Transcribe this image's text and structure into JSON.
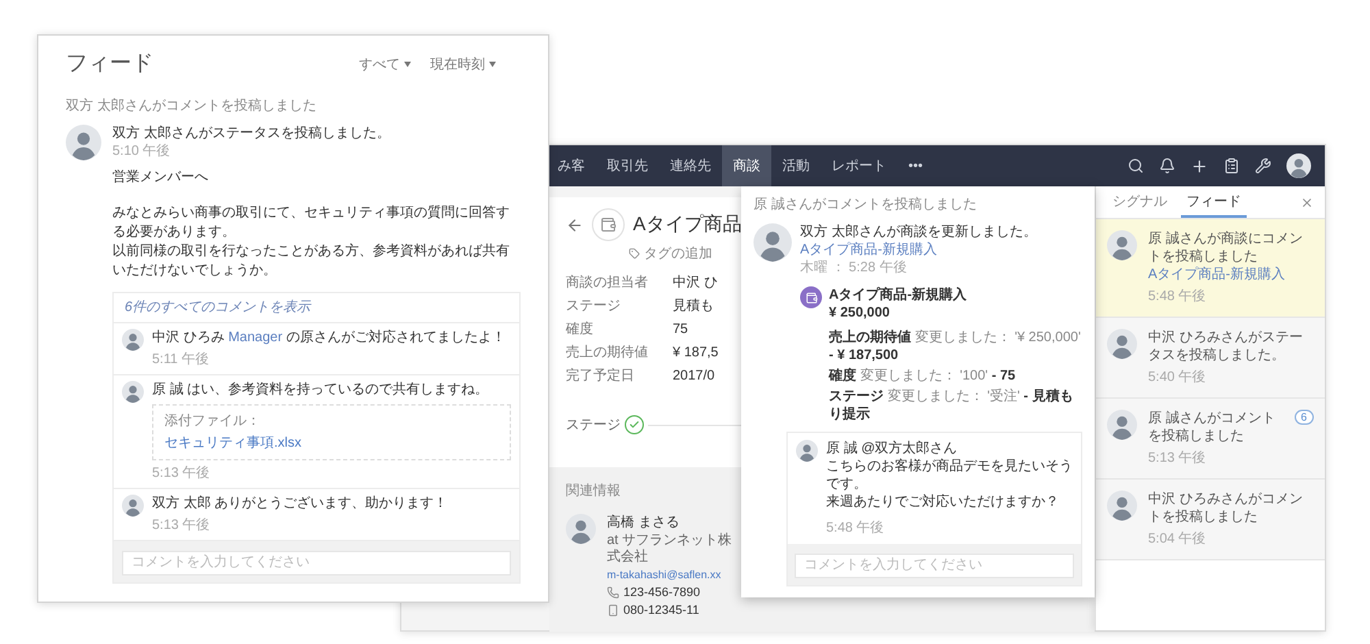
{
  "feed_window": {
    "title": "フィード",
    "filters": [
      {
        "label": "すべて"
      },
      {
        "label": "現在時刻"
      }
    ],
    "activity": "双方 太郎さんがコメントを投稿しました",
    "post": {
      "author_line": "双方 太郎さんがステータスを投稿しました。",
      "time": "5:10 午後",
      "greeting": "営業メンバーへ",
      "paragraphs": [
        "みなとみらい商事の取引にて、セキュリティ事項の質問に回答する必要があります。",
        "以前同様の取引を行なったことがある方、参考資料があれば共有いただけないでしょうか。"
      ]
    },
    "comments_link": "6件のすべてのコメントを表示",
    "comments": [
      {
        "author": "中沢 ひろみ",
        "mention": "Manager",
        "text": "の原さんがご対応されてましたよ！",
        "time": "5:11 午後"
      },
      {
        "author": "原 誠",
        "text": "はい、参考資料を持っているので共有しますね。",
        "attachment": {
          "label": "添付ファイル：",
          "file": "セキュリティ事項.xlsx"
        },
        "time": "5:13 午後"
      },
      {
        "author": "双方 太郎",
        "text": "ありがとうございます、助かります！",
        "time": "5:13 午後"
      }
    ],
    "comment_input": {
      "placeholder": "コメントを入力してください"
    }
  },
  "crm": {
    "nav": [
      {
        "label": "み客",
        "selected": false
      },
      {
        "label": "取引先",
        "selected": false
      },
      {
        "label": "連絡先",
        "selected": false
      },
      {
        "label": "商談",
        "selected": true
      },
      {
        "label": "活動",
        "selected": false
      },
      {
        "label": "レポート",
        "selected": false
      },
      {
        "label": "•••",
        "selected": false
      }
    ],
    "deal": {
      "title": "Aタイプ商品",
      "tag_action": "タグの追加",
      "fields": [
        {
          "label": "商談の担当者",
          "value": "中沢 ひ"
        },
        {
          "label": "ステージ",
          "value": "見積も"
        },
        {
          "label": "確度",
          "value": "75"
        },
        {
          "label": "売上の期待値",
          "value": "¥ 187,5"
        },
        {
          "label": "完了予定日",
          "value": "2017/0"
        }
      ],
      "stage_label": "ステージ"
    },
    "related": {
      "heading": "関連情報",
      "contact": {
        "name": "高橋 まさる",
        "company": "at サフランネット株式会社",
        "email": "m-takahashi@saflen.xx",
        "phone": "123-456-7890",
        "mobile": "080-12345-11"
      }
    }
  },
  "popup": {
    "heading": "原 誠さんがコメントを投稿しました",
    "update": {
      "text": "双方 太郎さんが商談を更新しました。",
      "link": "Aタイプ商品-新規購入",
      "time": "木曜 ： 5:28 午後"
    },
    "deal": {
      "name": "Aタイプ商品-新規購入",
      "amount": "¥ 250,000"
    },
    "changes": [
      {
        "field": "売上の期待値",
        "verb": "変更しました：",
        "from": "'¥ 250,000'",
        "to": "- ¥ 187,500"
      },
      {
        "field": "確度",
        "verb": "変更しました：",
        "from": "'100'",
        "to": "- 75"
      },
      {
        "field": "ステージ",
        "verb": "変更しました：",
        "from": "'受注'",
        "to": "- 見積もり提示"
      }
    ],
    "comment": {
      "author": "原 誠",
      "mention": "@双方太郎さん",
      "lines": [
        "こちらのお客様が商品デモを見たいそうです。",
        "来週あたりでご対応いただけますか？"
      ],
      "time": "5:48 午後"
    },
    "input_placeholder": "コメントを入力してください"
  },
  "side_panel": {
    "tabs": [
      {
        "label": "シグナル",
        "selected": false
      },
      {
        "label": "フィード",
        "selected": true
      }
    ],
    "items": [
      {
        "text": "原 誠さんが商談にコメントを投稿しました",
        "link": "Aタイプ商品-新規購入",
        "time": "5:48 午後",
        "highlighted": true
      },
      {
        "text": "中沢 ひろみさんがステータスを投稿しました。",
        "time": "5:40 午後",
        "highlighted": false
      },
      {
        "text": "原 誠さんがコメントを投稿しました",
        "time": "5:13 午後",
        "highlighted": false,
        "badge": "6"
      },
      {
        "text": "中沢 ひろみさんがコメントを投稿しました",
        "time": "5:04 午後",
        "highlighted": false
      }
    ]
  }
}
